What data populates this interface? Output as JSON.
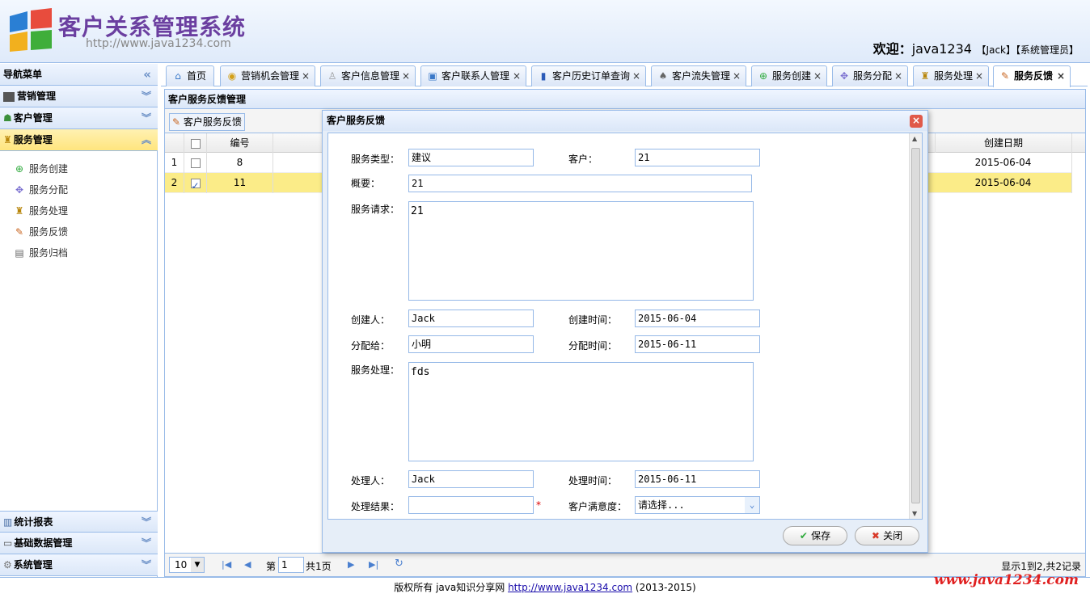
{
  "header": {
    "title": "客户关系管理系统",
    "url": "http://www.java1234.com",
    "welcome_prefix": "欢迎：",
    "user": "java1234",
    "user_detail": "【Jack】【系统管理员】"
  },
  "sidebar": {
    "title": "导航菜单",
    "sections": [
      {
        "label": "营销管理"
      },
      {
        "label": "客户管理"
      },
      {
        "label": "服务管理"
      }
    ],
    "items": [
      {
        "label": "服务创建"
      },
      {
        "label": "服务分配"
      },
      {
        "label": "服务处理"
      },
      {
        "label": "服务反馈"
      },
      {
        "label": "服务归档"
      }
    ],
    "bottom_sections": [
      {
        "label": "统计报表"
      },
      {
        "label": "基础数据管理"
      },
      {
        "label": "系统管理"
      }
    ]
  },
  "tabs": [
    {
      "label": "首页"
    },
    {
      "label": "营销机会管理"
    },
    {
      "label": "客户信息管理"
    },
    {
      "label": "客户联系人管理"
    },
    {
      "label": "客户历史订单查询"
    },
    {
      "label": "客户流失管理"
    },
    {
      "label": "服务创建"
    },
    {
      "label": "服务分配"
    },
    {
      "label": "服务处理"
    },
    {
      "label": "服务反馈"
    }
  ],
  "panel": {
    "title": "客户服务反馈管理",
    "toolbar_button": "客户服务反馈"
  },
  "grid": {
    "columns": {
      "id": "编号",
      "created": "创建日期"
    },
    "rows": [
      {
        "num": "1",
        "id": "8",
        "created": "2015-06-04"
      },
      {
        "num": "2",
        "id": "11",
        "created": "2015-06-04"
      }
    ]
  },
  "pager": {
    "page_size": "10",
    "page_prefix": "第",
    "page": "1",
    "page_total": "共1页",
    "summary": "显示1到2,共2记录"
  },
  "dialog": {
    "title": "客户服务反馈",
    "labels": {
      "type": "服务类型：",
      "customer": "客户：",
      "summary": "概要：",
      "request": "服务请求：",
      "creator": "创建人：",
      "create_time": "创建时间：",
      "assignee": "分配给：",
      "assign_time": "分配时间：",
      "handling": "服务处理：",
      "handler": "处理人：",
      "handle_time": "处理时间：",
      "result": "处理结果：",
      "satisfaction": "客户满意度："
    },
    "values": {
      "type": "建议",
      "customer": "21",
      "summary": "21",
      "request": "21",
      "creator": "Jack",
      "create_time": "2015-06-04",
      "assignee": "小明",
      "assign_time": "2015-06-11",
      "handling": "fds",
      "handler": "Jack",
      "handle_time": "2015-06-11",
      "result": "",
      "satisfaction": "请选择..."
    },
    "required_mark": "*",
    "save_label": "保存",
    "close_label": "关闭"
  },
  "footer": {
    "text": "版权所有 java知识分享网 ",
    "link": "http://www.java1234.com",
    "years": " (2013-2015)",
    "watermark": "www.java1234.com"
  }
}
